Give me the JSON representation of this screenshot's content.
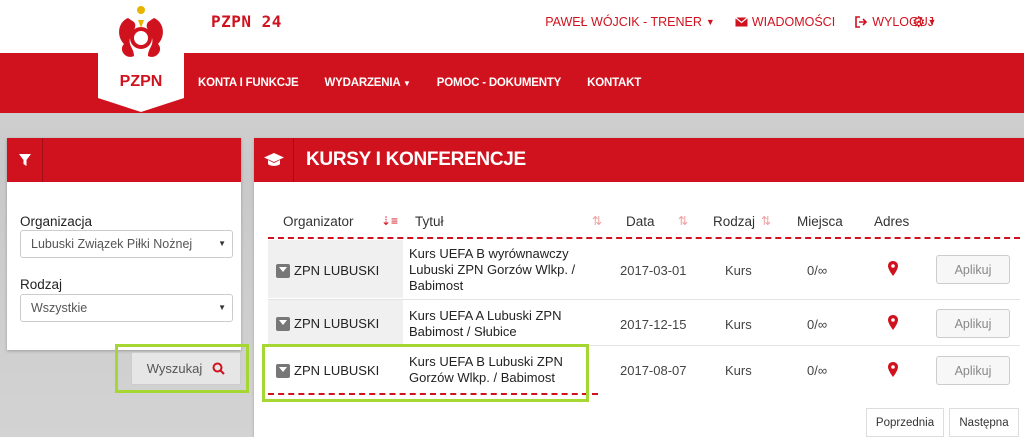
{
  "header": {
    "brand": "PZPN 24",
    "logo_text": "PZPN",
    "user_menu": "PAWEŁ WÓJCIK - TRENER",
    "messages": "WIADOMOŚCI",
    "logout": "WYLOGUJ"
  },
  "nav": {
    "items": [
      "KONTA I FUNKCJE",
      "WYDARZENIA",
      "POMOC - DOKUMENTY",
      "KONTAKT"
    ]
  },
  "filter": {
    "org_label": "Organizacja",
    "org_value": "Lubuski Związek Piłki Nożnej",
    "kind_label": "Rodzaj",
    "kind_value": "Wszystkie",
    "search_label": "Wyszukaj"
  },
  "main": {
    "title": "KURSY I KONFERENCJE",
    "columns": [
      "Organizator",
      "Tytuł",
      "Data",
      "Rodzaj",
      "Miejsca",
      "Adres"
    ],
    "rows": [
      {
        "org": "ZPN LUBUSKI",
        "title": "Kurs UEFA B wyrównawczy Lubuski ZPN Gorzów Wlkp. / Babimost",
        "date": "2017-03-01",
        "kind": "Kurs",
        "places": "0/∞",
        "apply": "Aplikuj"
      },
      {
        "org": "ZPN LUBUSKI",
        "title": "Kurs UEFA A Lubuski ZPN Babimost / Słubice",
        "date": "2017-12-15",
        "kind": "Kurs",
        "places": "0/∞",
        "apply": "Aplikuj"
      },
      {
        "org": "ZPN LUBUSKI",
        "title": "Kurs UEFA B Lubuski ZPN Gorzów Wlkp. / Babimost",
        "date": "2017-08-07",
        "kind": "Kurs",
        "places": "0/∞",
        "apply": "Aplikuj"
      }
    ],
    "prev": "Poprzednia",
    "next": "Następna"
  },
  "colors": {
    "brand_red": "#d0121e",
    "highlight_green": "#a5d631"
  }
}
